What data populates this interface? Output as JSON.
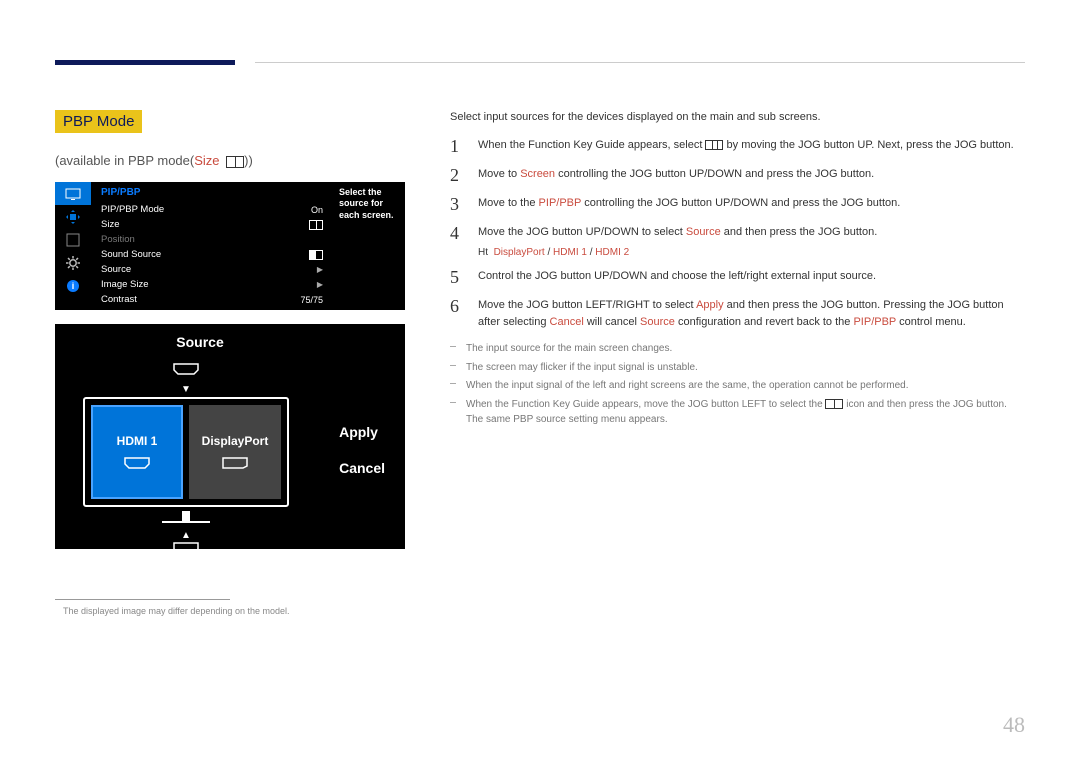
{
  "page_number": "48",
  "section": {
    "title": "PBP Mode",
    "subtitle_prefix": "(available in PBP mode(",
    "subtitle_size_label": "Size",
    "subtitle_suffix": "))"
  },
  "osd": {
    "header": "PIP/PBP",
    "hint": "Select the source for each screen.",
    "rows": {
      "mode_label": "PIP/PBP Mode",
      "mode_value": "On",
      "size_label": "Size",
      "position_label": "Position",
      "sound_label": "Sound Source",
      "source_label": "Source",
      "image_size_label": "Image Size",
      "contrast_label": "Contrast",
      "contrast_value": "75/75"
    }
  },
  "source_panel": {
    "title": "Source",
    "left_label": "HDMI 1",
    "right_label": "DisplayPort",
    "apply": "Apply",
    "cancel": "Cancel"
  },
  "footnote": "The displayed image may differ depending on the model.",
  "intro": "Select input sources for the devices displayed on the main and sub screens.",
  "steps": {
    "s1": {
      "n": "1",
      "pre": "When the Function Key Guide appears, select ",
      "post": " by moving the JOG button UP. Next, press the JOG button."
    },
    "s2": {
      "n": "2",
      "pre": "Move to ",
      "red": "Screen",
      "post": " controlling the JOG button UP/DOWN and press the JOG button."
    },
    "s3": {
      "n": "3",
      "pre": "Move to the ",
      "red": "PIP/PBP",
      "post": " controlling the JOG button UP/DOWN and press the JOG button."
    },
    "s4": {
      "n": "4",
      "pre": "Move the JOG button UP/DOWN to select ",
      "red": "Source",
      "post": " and then press the JOG button."
    },
    "s5_prefix": "Ht",
    "s5_opts": {
      "a": "DisplayPort",
      "b": "HDMI 1",
      "c": "HDMI 2"
    },
    "s5": {
      "n": "5",
      "text": "Control the JOG button UP/DOWN and choose the left/right external input source."
    },
    "s6": {
      "n": "6",
      "pre": "Move the JOG button LEFT/RIGHT to select ",
      "red": "Apply",
      "post": " and then press the JOG button. Pressing the JOG button after selecting "
    },
    "s6b": {
      "red1": "Cancel",
      "mid": " will cancel ",
      "red2": "Source",
      "mid2": " configuration and revert back to the ",
      "red3": "PIP/PBP",
      "post": " control menu."
    }
  },
  "notes": {
    "n1": "The input source for the main screen changes.",
    "n2": "The screen may flicker if the input signal is unstable.",
    "n3": "When the input signal of the left and right screens are the same, the operation cannot be performed.",
    "n4a": "When the Function Key Guide appears, move the JOG button LEFT to select the ",
    "n4b": " icon and then press the JOG button. The same PBP source setting menu appears."
  }
}
